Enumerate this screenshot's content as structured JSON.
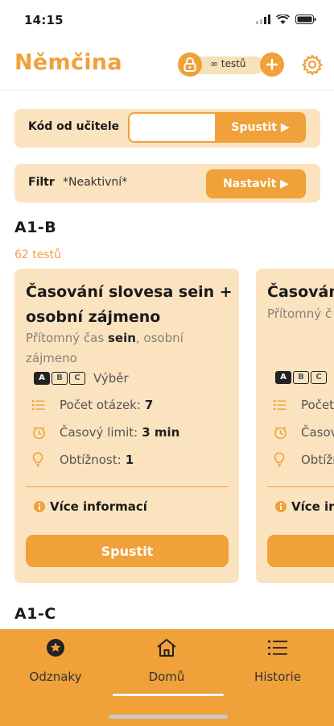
{
  "status": {
    "time": "14:15"
  },
  "header": {
    "title": "Němčina",
    "tests_label": "∞ testů",
    "icons": [
      "lock-icon",
      "plus-icon",
      "gear-icon"
    ]
  },
  "code_panel": {
    "label": "Kód od učitele",
    "input_value": "",
    "run_label": "Spustit ▶"
  },
  "filter_panel": {
    "label": "Filtr",
    "value": "*Neaktivní*",
    "button_label": "Nastavit ▶"
  },
  "sections": [
    {
      "title": "A1-B",
      "count": "62 testů",
      "cards": [
        {
          "title": "Časování slovesa sein + osobní zájmeno",
          "subtitle_pre": "Přítomný čas ",
          "subtitle_bold": "sein",
          "subtitle_post": ", osobní zájmeno",
          "type_label": "Výběr",
          "abc": [
            "A",
            "B",
            "C"
          ],
          "questions_label": "Počet otázek:",
          "questions_value": "7",
          "time_label": "Časový limit:",
          "time_value": "3 min",
          "difficulty_label": "Obtížnost:",
          "difficulty_value": "1",
          "more_info": "Více informací",
          "run_label": "Spustit"
        },
        {
          "title": "Časování",
          "subtitle_pre": "Přítomný č",
          "type_label": "",
          "abc": [
            "A",
            "B",
            "C"
          ],
          "questions_label": "Počet",
          "time_label": "Časov",
          "difficulty_label": "Obtížno",
          "more_info": "Více in",
          "run_label": ""
        }
      ]
    },
    {
      "title": "A1-C"
    }
  ],
  "bottom_nav": {
    "items": [
      {
        "label": "Odznaky",
        "icon": "badge-star-icon"
      },
      {
        "label": "Domů",
        "icon": "home-icon"
      },
      {
        "label": "Historie",
        "icon": "list-icon"
      }
    ],
    "active": "Domů"
  },
  "colors": {
    "accent": "#f0a13a",
    "panel": "#fbe3c0",
    "pill": "#f8e0b8"
  }
}
